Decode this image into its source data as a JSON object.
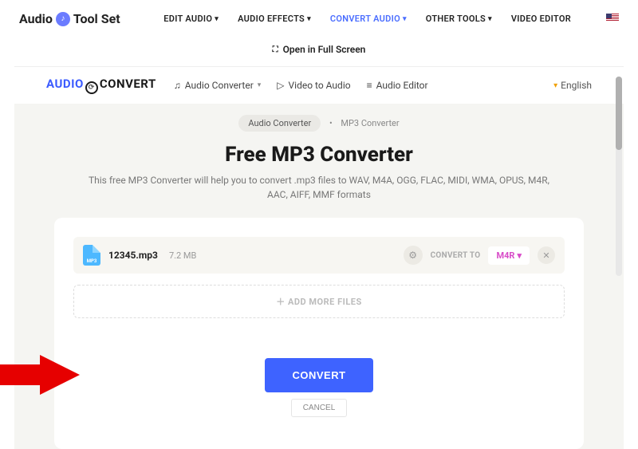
{
  "brand": {
    "a": "Audio",
    "b": "Tool Set"
  },
  "topnav": {
    "edit": "EDIT AUDIO",
    "effects": "AUDIO EFFECTS",
    "convert": "CONVERT AUDIO",
    "other": "OTHER TOOLS",
    "video": "VIDEO EDITOR"
  },
  "fullscreen": "Open in Full Screen",
  "sub_brand": {
    "a": "AUDIO",
    "b": "CONVERT"
  },
  "subnav": {
    "converter": "Audio Converter",
    "video": "Video to Audio",
    "editor": "Audio Editor"
  },
  "language": "English",
  "crumbs": {
    "a": "Audio Converter",
    "b": "MP3 Converter"
  },
  "page": {
    "title": "Free MP3 Converter",
    "subtitle": "This free MP3 Converter will help you to convert .mp3 files to WAV, M4A, OGG, FLAC, MIDI, WMA, OPUS, M4R, AAC, AIFF, MMF formats"
  },
  "file": {
    "icon_label": "MP3",
    "name": "12345.mp3",
    "size": "7.2 MB",
    "convert_to_label": "CONVERT TO",
    "format": "M4R"
  },
  "add_more": "ADD MORE FILES",
  "actions": {
    "convert": "CONVERT",
    "cancel": "CANCEL"
  }
}
